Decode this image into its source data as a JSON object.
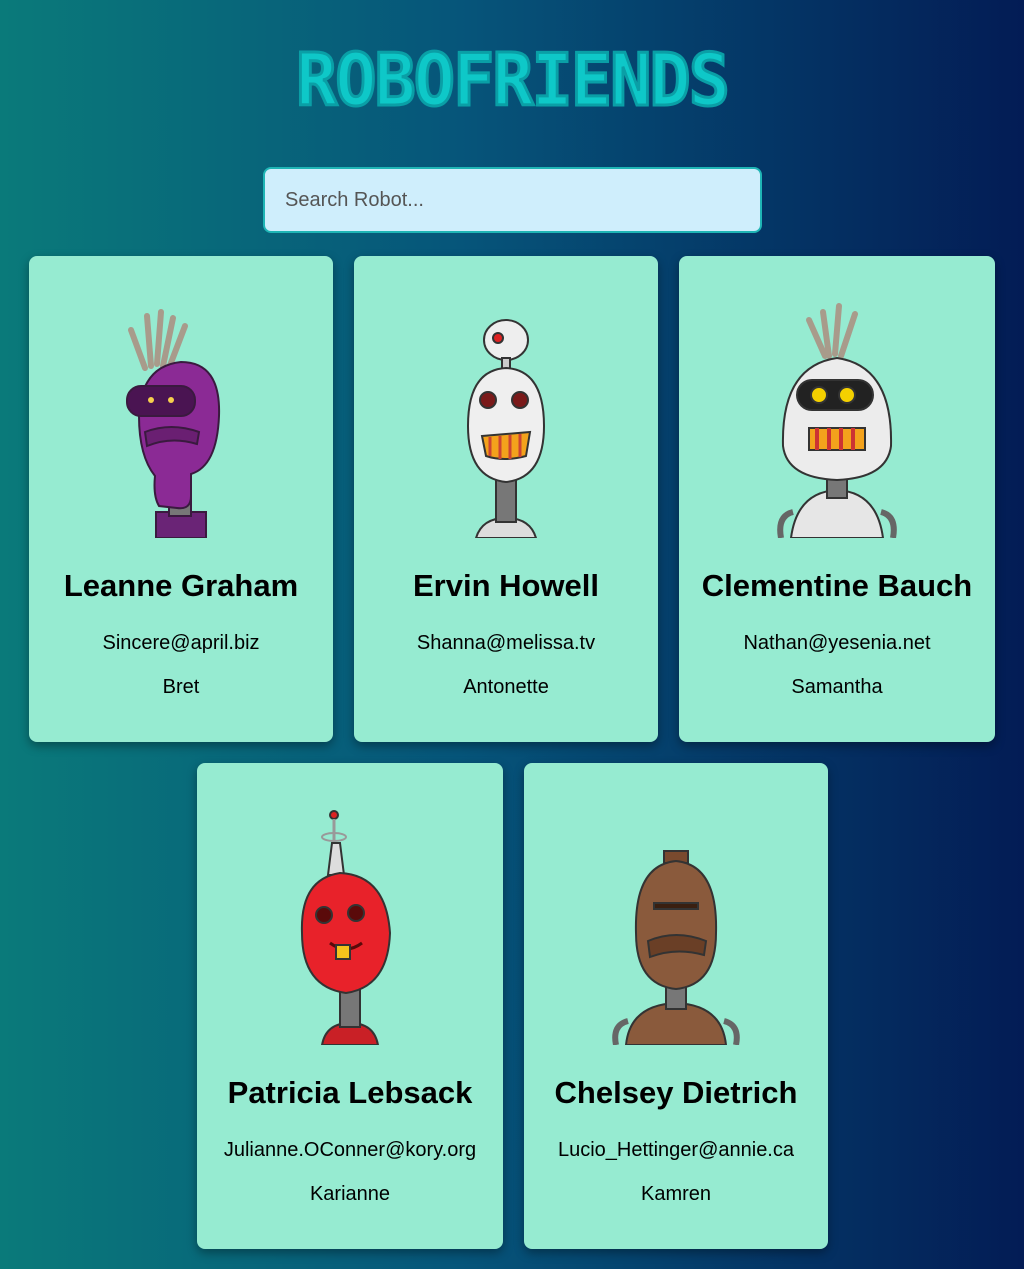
{
  "app": {
    "title": "ROBOFRIENDS"
  },
  "search": {
    "placeholder": "Search Robot..."
  },
  "robots": [
    {
      "name": "Leanne Graham",
      "email": "Sincere@april.biz",
      "username": "Bret",
      "color": "#8b2a95"
    },
    {
      "name": "Ervin Howell",
      "email": "Shanna@melissa.tv",
      "username": "Antonette",
      "color": "#e9e9e9"
    },
    {
      "name": "Clementine Bauch",
      "email": "Nathan@yesenia.net",
      "username": "Samantha",
      "color": "#e6e6e6"
    },
    {
      "name": "Patricia Lebsack",
      "email": "Julianne.OConner@kory.org",
      "username": "Karianne",
      "color": "#e8222a"
    },
    {
      "name": "Chelsey Dietrich",
      "email": "Lucio_Hettinger@annie.ca",
      "username": "Kamren",
      "color": "#8a5a3c"
    }
  ]
}
